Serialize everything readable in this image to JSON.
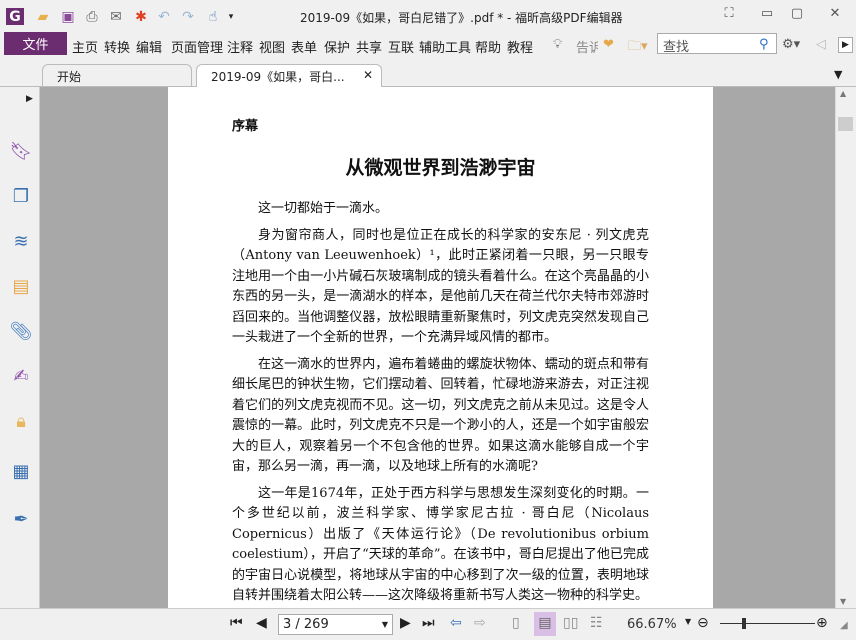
{
  "window": {
    "title": "2019-09《如果，哥白尼错了》.pdf * - 福昕高级PDF编辑器"
  },
  "menu": {
    "file": "文件",
    "items": [
      "主页",
      "转换",
      "编辑",
      "页面管理",
      "注释",
      "视图",
      "表单",
      "保护",
      "共享",
      "互联",
      "辅助工具",
      "帮助",
      "教程"
    ],
    "tell_me": "告诉",
    "search_placeholder": "查找"
  },
  "tabs": [
    {
      "label": "开始"
    },
    {
      "label": "2019-09《如果，哥白..."
    }
  ],
  "document": {
    "section": "序幕",
    "title": "从微观世界到浩渺宇宙",
    "paragraphs": [
      "这一切都始于一滴水。",
      "身为窗帘商人，同时也是位正在成长的科学家的安东尼 · 列文虎克（Antony van Leeuwenhoek）¹，此时正紧闭着一只眼，另一只眼专注地用一个由一小片碱石灰玻璃制成的镜头看着什么。在这个亮晶晶的小东西的另一头，是一滴湖水的样本，是他前几天在荷兰代尔夫特市郊游时舀回来的。当他调整仪器，放松眼睛重新聚焦时，列文虎克突然发现自己一头栽进了一个全新的世界，一个充满异域风情的都市。",
      "在这一滴水的世界内，遍布着蜷曲的螺旋状物体、蠕动的斑点和带有细长尾巴的钟状生物，它们摆动着、回转着，忙碌地游来游去，对正注视着它们的列文虎克视而不见。这一切，列文虎克之前从未见过。这是令人震惊的一幕。此时，列文虎克不只是一个渺小的人，还是一个如宇宙般宏大的巨人，观察着另一个不包含他的世界。如果这滴水能够自成一个宇宙，那么另一滴，再一滴，以及地球上所有的水滴呢?",
      "这一年是1674年，正处于西方科学与思想发生深刻变化的时期。一个多世纪以前，波兰科学家、博学家尼古拉 · 哥白尼（Nicolaus Copernicus）出版了《天体运行论》（De revolutionibus orbium coelestium），开启了“天球的革命”。在该书中，哥白尼提出了他已完成的宇宙日心说模型，将地球从宇宙的中心移到了次一级的位置，表明地球自转并围绕着太阳公转——这次降级将重新书写人类这一物种的科学史。"
    ]
  },
  "status": {
    "page": "3 / 269",
    "zoom": "66.67%",
    "zoom_level": 0.55
  },
  "colors": {
    "brand": "#6b2d70"
  }
}
